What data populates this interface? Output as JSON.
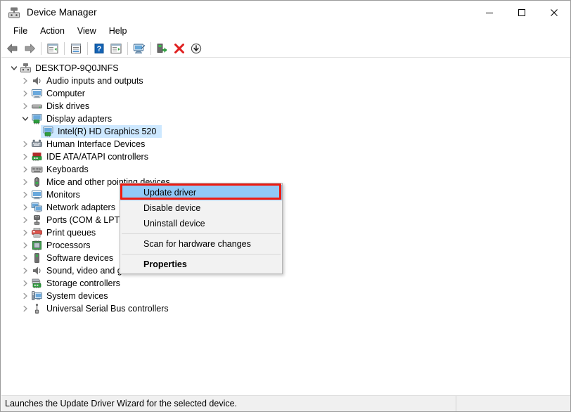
{
  "window": {
    "title": "Device Manager",
    "title_icon": "device-manager-icon",
    "controls": {
      "minimize": "minimize-icon",
      "maximize": "maximize-icon",
      "close": "close-icon"
    }
  },
  "menubar": {
    "items": [
      {
        "label": "File"
      },
      {
        "label": "Action"
      },
      {
        "label": "View"
      },
      {
        "label": "Help"
      }
    ]
  },
  "toolbar": {
    "buttons": [
      {
        "name": "back-arrow-icon",
        "tooltip": "Back"
      },
      {
        "name": "forward-arrow-icon",
        "tooltip": "Forward"
      },
      {
        "name": "show-hide-console-tree-icon",
        "tooltip": "Show/Hide Console Tree"
      },
      {
        "name": "properties-icon",
        "tooltip": "Properties"
      },
      {
        "name": "help-icon",
        "tooltip": "Help"
      },
      {
        "name": "view-details-icon",
        "tooltip": "View"
      },
      {
        "name": "scan-for-hardware-changes-icon",
        "tooltip": "Scan for hardware changes"
      },
      {
        "name": "update-driver-icon",
        "tooltip": "Update driver"
      },
      {
        "name": "uninstall-device-icon",
        "tooltip": "Uninstall device"
      },
      {
        "name": "disable-device-icon",
        "tooltip": "Disable device"
      }
    ]
  },
  "tree": {
    "root": {
      "label": "DESKTOP-9Q0JNFS",
      "icon": "computer-root-icon",
      "expanded": true
    },
    "nodes": [
      {
        "label": "Audio inputs and outputs",
        "icon": "speaker-icon",
        "expanded": false,
        "level": 1
      },
      {
        "label": "Computer",
        "icon": "monitor-icon",
        "expanded": false,
        "level": 1
      },
      {
        "label": "Disk drives",
        "icon": "disk-drive-icon",
        "expanded": false,
        "level": 1
      },
      {
        "label": "Display adapters",
        "icon": "display-adapter-icon",
        "expanded": true,
        "level": 1
      },
      {
        "label": "Intel(R) HD Graphics 520",
        "icon": "display-adapter-icon",
        "selected": true,
        "level": 2
      },
      {
        "label": "Human Interface Devices",
        "icon": "hid-icon",
        "expanded": false,
        "level": 1
      },
      {
        "label": "IDE ATA/ATAPI controllers",
        "icon": "ide-controller-icon",
        "expanded": false,
        "level": 1
      },
      {
        "label": "Keyboards",
        "icon": "keyboard-icon",
        "expanded": false,
        "level": 1
      },
      {
        "label": "Mice and other pointing devices",
        "icon": "mouse-icon",
        "expanded": false,
        "level": 1
      },
      {
        "label": "Monitors",
        "icon": "monitor-icon",
        "expanded": false,
        "level": 1
      },
      {
        "label": "Network adapters",
        "icon": "network-adapter-icon",
        "expanded": false,
        "level": 1
      },
      {
        "label": "Ports (COM & LPT)",
        "icon": "port-icon",
        "expanded": false,
        "level": 1
      },
      {
        "label": "Print queues",
        "icon": "printer-icon",
        "expanded": false,
        "level": 1
      },
      {
        "label": "Processors",
        "icon": "processor-icon",
        "expanded": false,
        "level": 1
      },
      {
        "label": "Software devices",
        "icon": "software-device-icon",
        "expanded": false,
        "level": 1
      },
      {
        "label": "Sound, video and game controllers",
        "icon": "speaker-icon",
        "expanded": false,
        "level": 1
      },
      {
        "label": "Storage controllers",
        "icon": "storage-controller-icon",
        "expanded": false,
        "level": 1
      },
      {
        "label": "System devices",
        "icon": "system-device-icon",
        "expanded": false,
        "level": 1
      },
      {
        "label": "Universal Serial Bus controllers",
        "icon": "usb-icon",
        "expanded": false,
        "level": 1
      }
    ]
  },
  "context_menu": {
    "items": [
      {
        "label": "Update driver",
        "highlighted": true,
        "bold": false
      },
      {
        "label": "Disable device",
        "highlighted": false,
        "bold": false
      },
      {
        "label": "Uninstall device",
        "highlighted": false,
        "bold": false
      },
      {
        "separator_after": true
      },
      {
        "label": "Scan for hardware changes",
        "highlighted": false,
        "bold": false
      },
      {
        "separator_after": true
      },
      {
        "label": "Properties",
        "highlighted": false,
        "bold": true
      }
    ],
    "highlight_color": "#91c9f7",
    "annotation_box_color": "#ee1b11"
  },
  "statusbar": {
    "text": "Launches the Update Driver Wizard for the selected device."
  }
}
